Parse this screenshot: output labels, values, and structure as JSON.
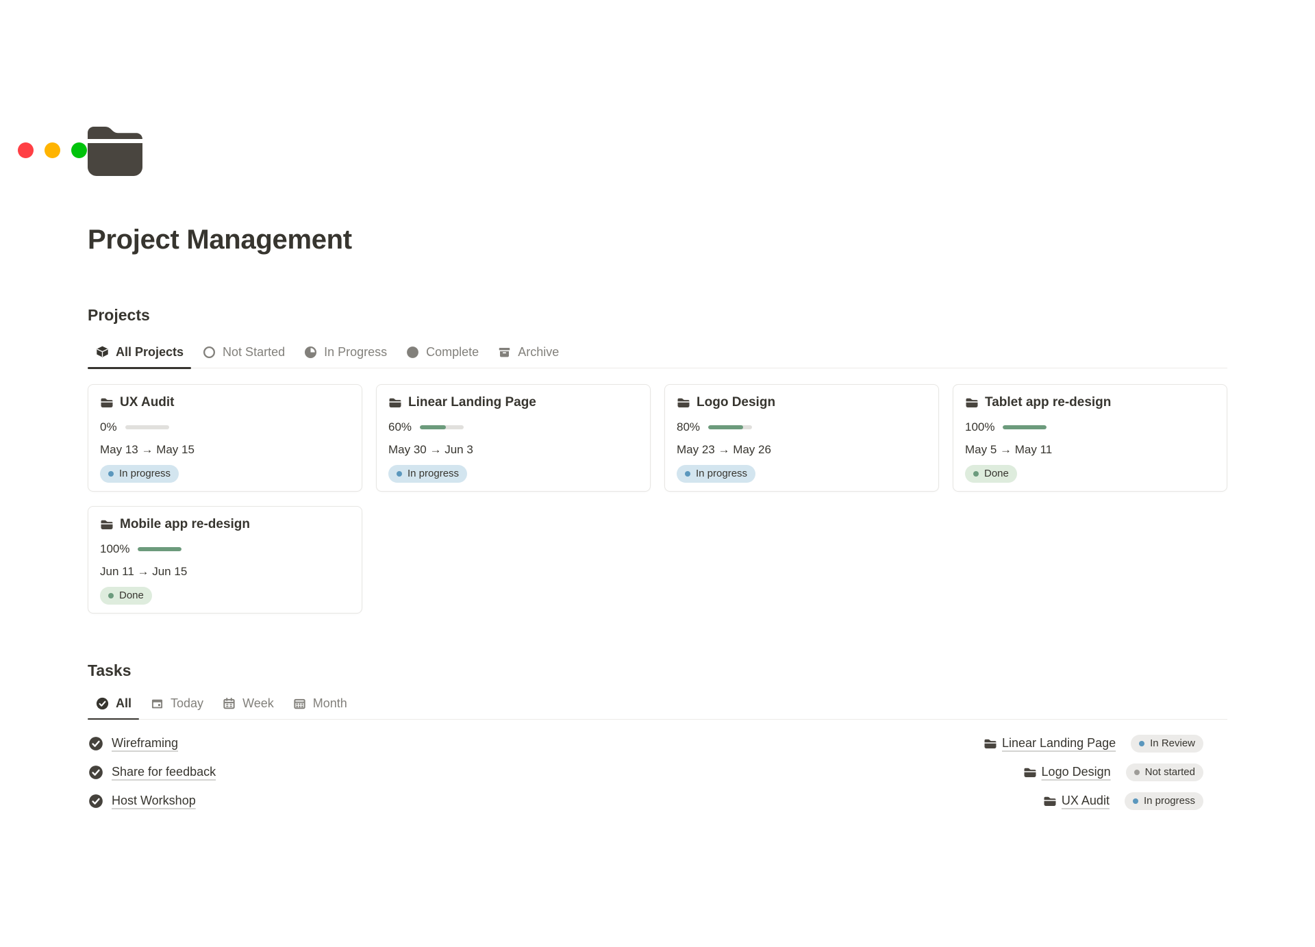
{
  "window": {
    "traffic_lights": [
      "#FF3F44",
      "#FFB401",
      "#00C30B"
    ]
  },
  "page": {
    "icon": "folder-icon",
    "title": "Project Management"
  },
  "projects": {
    "heading": "Projects",
    "tabs": [
      {
        "label": "All Projects",
        "icon": "box-icon",
        "active": true
      },
      {
        "label": "Not Started",
        "icon": "circle-outline-icon",
        "active": false
      },
      {
        "label": "In Progress",
        "icon": "circle-progress-icon",
        "active": false
      },
      {
        "label": "Complete",
        "icon": "circle-filled-icon",
        "active": false
      },
      {
        "label": "Archive",
        "icon": "archive-icon",
        "active": false
      }
    ],
    "cards": [
      {
        "name": "UX Audit",
        "percent": "0%",
        "progress": 0,
        "dates": "May 13 → May 15",
        "status": {
          "label": "In progress",
          "variant": "blue"
        }
      },
      {
        "name": "Linear Landing Page",
        "percent": "60%",
        "progress": 60,
        "dates": "May 30 → Jun 3",
        "status": {
          "label": "In progress",
          "variant": "blue"
        }
      },
      {
        "name": "Logo Design",
        "percent": "80%",
        "progress": 80,
        "dates": "May 23 → May 26",
        "status": {
          "label": "In progress",
          "variant": "blue"
        }
      },
      {
        "name": "Tablet app re-design",
        "percent": "100%",
        "progress": 100,
        "dates": "May 5 → May 11",
        "status": {
          "label": "Done",
          "variant": "green"
        }
      },
      {
        "name": "Mobile app re-design",
        "percent": "100%",
        "progress": 100,
        "dates": "Jun 11 → Jun 15",
        "status": {
          "label": "Done",
          "variant": "green"
        }
      }
    ]
  },
  "tasks": {
    "heading": "Tasks",
    "tabs": [
      {
        "label": "All",
        "icon": "check-circle-icon",
        "active": true
      },
      {
        "label": "Today",
        "icon": "calendar-today-icon",
        "active": false
      },
      {
        "label": "Week",
        "icon": "calendar-week-icon",
        "active": false
      },
      {
        "label": "Month",
        "icon": "calendar-month-icon",
        "active": false
      }
    ],
    "rows": [
      {
        "task": "Wireframing",
        "project": "Linear Landing Page",
        "status": {
          "label": "In Review",
          "variant": "gray-blue"
        }
      },
      {
        "task": "Share for feedback",
        "project": "Logo Design",
        "status": {
          "label": "Not started",
          "variant": "gray"
        }
      },
      {
        "task": "Host Workshop",
        "project": "UX Audit",
        "status": {
          "label": "In progress",
          "variant": "gray-blue"
        }
      }
    ]
  },
  "colors": {
    "accent_text": "#37352F",
    "muted_text": "#82807B",
    "icon_dark": "#49453F",
    "border": "#ECEBE8",
    "card_border": "#E7E6E3",
    "progress_green": "#6C9B7C",
    "progress_track": "#E1E0DD",
    "badge_blue_bg": "#D3E5EF",
    "badge_blue_dot": "#5B97BD",
    "badge_green_bg": "#DEECDD",
    "badge_green_dot": "#6C9B7D",
    "badge_gray_bg": "#ECEBE9",
    "badge_gray_dot": "#9E9C98"
  }
}
